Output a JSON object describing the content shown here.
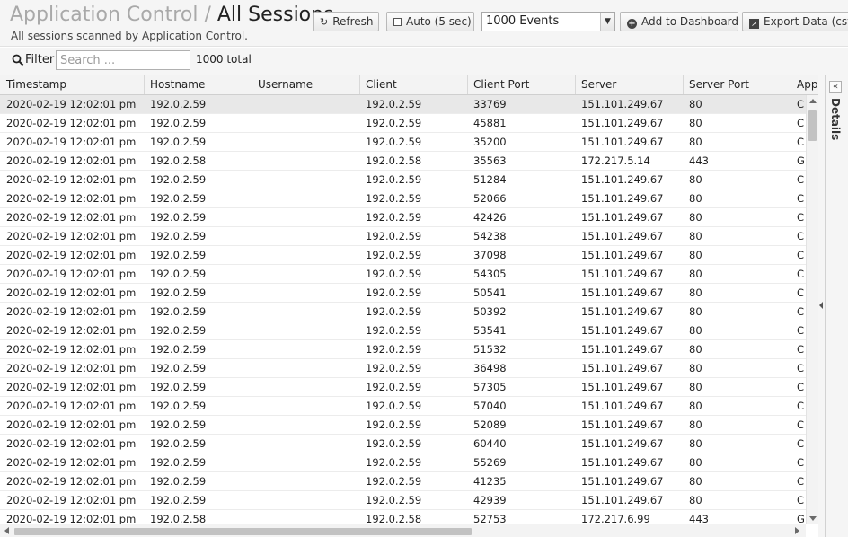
{
  "header": {
    "app_title": "Application Control",
    "separator": "/",
    "page_title": "All Sessions",
    "subtitle": "All sessions scanned by Application Control."
  },
  "toolbar": {
    "refresh_label": "Refresh",
    "auto_label": "Auto (5 sec)",
    "events_selected": "1000 Events",
    "add_dashboard_label": "Add to Dashboard",
    "export_label": "Export Data (csv)"
  },
  "filter": {
    "label": "Filter",
    "placeholder": "Search ...",
    "total": "1000 total"
  },
  "table": {
    "columns": [
      "Timestamp",
      "Hostname",
      "Username",
      "Client",
      "Client Port",
      "Server",
      "Server Port",
      "Application"
    ],
    "rows": [
      [
        "2020-02-19 12:02:01 pm",
        "192.0.2.59",
        "",
        "192.0.2.59",
        "33769",
        "151.101.249.67",
        "80",
        "C"
      ],
      [
        "2020-02-19 12:02:01 pm",
        "192.0.2.59",
        "",
        "192.0.2.59",
        "45881",
        "151.101.249.67",
        "80",
        "C"
      ],
      [
        "2020-02-19 12:02:01 pm",
        "192.0.2.59",
        "",
        "192.0.2.59",
        "35200",
        "151.101.249.67",
        "80",
        "C"
      ],
      [
        "2020-02-19 12:02:01 pm",
        "192.0.2.58",
        "",
        "192.0.2.58",
        "35563",
        "172.217.5.14",
        "443",
        "G"
      ],
      [
        "2020-02-19 12:02:01 pm",
        "192.0.2.59",
        "",
        "192.0.2.59",
        "51284",
        "151.101.249.67",
        "80",
        "C"
      ],
      [
        "2020-02-19 12:02:01 pm",
        "192.0.2.59",
        "",
        "192.0.2.59",
        "52066",
        "151.101.249.67",
        "80",
        "C"
      ],
      [
        "2020-02-19 12:02:01 pm",
        "192.0.2.59",
        "",
        "192.0.2.59",
        "42426",
        "151.101.249.67",
        "80",
        "C"
      ],
      [
        "2020-02-19 12:02:01 pm",
        "192.0.2.59",
        "",
        "192.0.2.59",
        "54238",
        "151.101.249.67",
        "80",
        "C"
      ],
      [
        "2020-02-19 12:02:01 pm",
        "192.0.2.59",
        "",
        "192.0.2.59",
        "37098",
        "151.101.249.67",
        "80",
        "C"
      ],
      [
        "2020-02-19 12:02:01 pm",
        "192.0.2.59",
        "",
        "192.0.2.59",
        "54305",
        "151.101.249.67",
        "80",
        "C"
      ],
      [
        "2020-02-19 12:02:01 pm",
        "192.0.2.59",
        "",
        "192.0.2.59",
        "50541",
        "151.101.249.67",
        "80",
        "C"
      ],
      [
        "2020-02-19 12:02:01 pm",
        "192.0.2.59",
        "",
        "192.0.2.59",
        "50392",
        "151.101.249.67",
        "80",
        "C"
      ],
      [
        "2020-02-19 12:02:01 pm",
        "192.0.2.59",
        "",
        "192.0.2.59",
        "53541",
        "151.101.249.67",
        "80",
        "C"
      ],
      [
        "2020-02-19 12:02:01 pm",
        "192.0.2.59",
        "",
        "192.0.2.59",
        "51532",
        "151.101.249.67",
        "80",
        "C"
      ],
      [
        "2020-02-19 12:02:01 pm",
        "192.0.2.59",
        "",
        "192.0.2.59",
        "36498",
        "151.101.249.67",
        "80",
        "C"
      ],
      [
        "2020-02-19 12:02:01 pm",
        "192.0.2.59",
        "",
        "192.0.2.59",
        "57305",
        "151.101.249.67",
        "80",
        "C"
      ],
      [
        "2020-02-19 12:02:01 pm",
        "192.0.2.59",
        "",
        "192.0.2.59",
        "57040",
        "151.101.249.67",
        "80",
        "C"
      ],
      [
        "2020-02-19 12:02:01 pm",
        "192.0.2.59",
        "",
        "192.0.2.59",
        "52089",
        "151.101.249.67",
        "80",
        "C"
      ],
      [
        "2020-02-19 12:02:01 pm",
        "192.0.2.59",
        "",
        "192.0.2.59",
        "60440",
        "151.101.249.67",
        "80",
        "C"
      ],
      [
        "2020-02-19 12:02:01 pm",
        "192.0.2.59",
        "",
        "192.0.2.59",
        "55269",
        "151.101.249.67",
        "80",
        "C"
      ],
      [
        "2020-02-19 12:02:01 pm",
        "192.0.2.59",
        "",
        "192.0.2.59",
        "41235",
        "151.101.249.67",
        "80",
        "C"
      ],
      [
        "2020-02-19 12:02:01 pm",
        "192.0.2.59",
        "",
        "192.0.2.59",
        "42939",
        "151.101.249.67",
        "80",
        "C"
      ],
      [
        "2020-02-19 12:02:01 pm",
        "192.0.2.58",
        "",
        "192.0.2.58",
        "52753",
        "172.217.6.99",
        "443",
        "G"
      ]
    ]
  },
  "details": {
    "label": "Details"
  }
}
